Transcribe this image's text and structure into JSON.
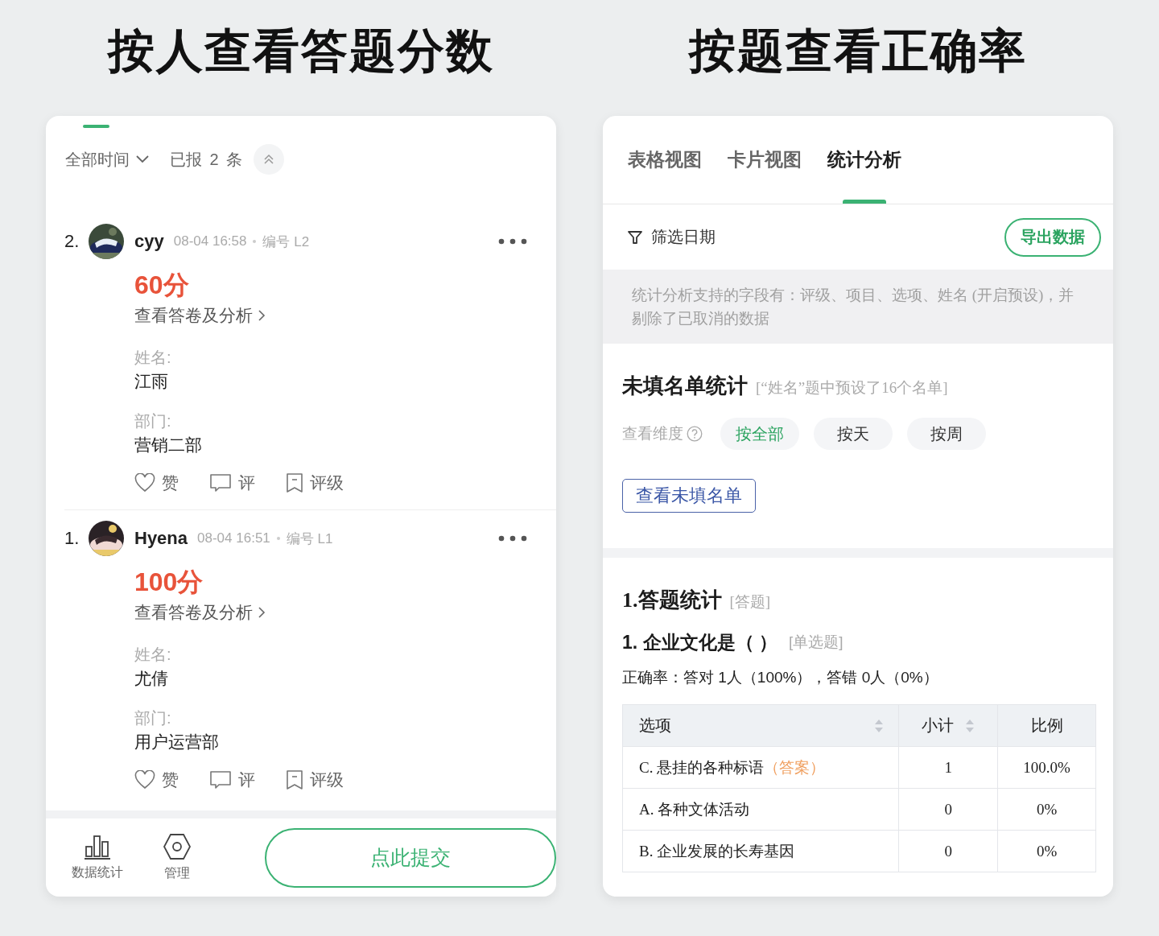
{
  "headings": [
    "按人查看答题分数",
    "按题查看正确率"
  ],
  "scores": {
    "time_filter": "全部时间",
    "count": "已报 2 条",
    "entries": [
      {
        "index": "2.",
        "name": "cyy",
        "time": "08-04 16:58",
        "serial": "编号 L2",
        "score": "60分",
        "link": "查看答卷及分析",
        "fields": [
          {
            "label": "姓名:",
            "value": "江雨"
          },
          {
            "label": "部门:",
            "value": "营销二部"
          }
        ],
        "actions": [
          {
            "kind": "like",
            "label": "赞"
          },
          {
            "kind": "comment",
            "label": "评"
          },
          {
            "kind": "rate",
            "label": "评级"
          }
        ]
      },
      {
        "index": "1.",
        "name": "Hyena",
        "time": "08-04 16:51",
        "serial": "编号 L1",
        "score": "100分",
        "link": "查看答卷及分析",
        "fields": [
          {
            "label": "姓名:",
            "value": "尤倩"
          },
          {
            "label": "部门:",
            "value": "用户运营部"
          }
        ],
        "actions": [
          {
            "kind": "like",
            "label": "赞"
          },
          {
            "kind": "comment",
            "label": "评"
          },
          {
            "kind": "rate",
            "label": "评级"
          }
        ]
      }
    ],
    "nav": [
      {
        "kind": "chart",
        "label": "数据统计"
      },
      {
        "kind": "settings",
        "label": "管理"
      }
    ],
    "submit": "点此提交"
  },
  "stats": {
    "tabs": [
      {
        "label": "表格视图",
        "selected": false
      },
      {
        "label": "卡片视图",
        "selected": false
      },
      {
        "label": "统计分析",
        "selected": true
      }
    ],
    "filter": "筛选日期",
    "export": "导出数据",
    "notice": "统计分析支持的字段有：评级、项目、选项、姓名 (开启预设)，并剔除了已取消的数据",
    "unfilled": {
      "title": "未填名单统计",
      "note": "[“姓名”题中预设了16个名单]",
      "dimension_label": "查看维度",
      "options": [
        {
          "label": "按全部",
          "selected": true
        },
        {
          "label": "按天",
          "selected": false
        },
        {
          "label": "按周",
          "selected": false
        }
      ],
      "button": "查看未填名单"
    },
    "section": {
      "title": "1.答题统计",
      "tag": "[答题]",
      "question": "1. 企业文化是（ ）",
      "question_type": "[单选题]",
      "accuracy": "正确率：答对 1人（100%），答错 0人（0%）",
      "columns": [
        {
          "label": "选项",
          "sortable": true
        },
        {
          "label": "小计",
          "sortable": true
        },
        {
          "label": "比例",
          "sortable": false
        }
      ],
      "rows": [
        {
          "option": "C. 悬挂的各种标语",
          "answer_tag": "（答案）",
          "count": "1",
          "ratio": "100.0%"
        },
        {
          "option": "A. 各种文体活动",
          "count": "0",
          "ratio": "0%"
        },
        {
          "option": "B. 企业发展的长寿基因",
          "count": "0",
          "ratio": "0%"
        }
      ]
    }
  }
}
